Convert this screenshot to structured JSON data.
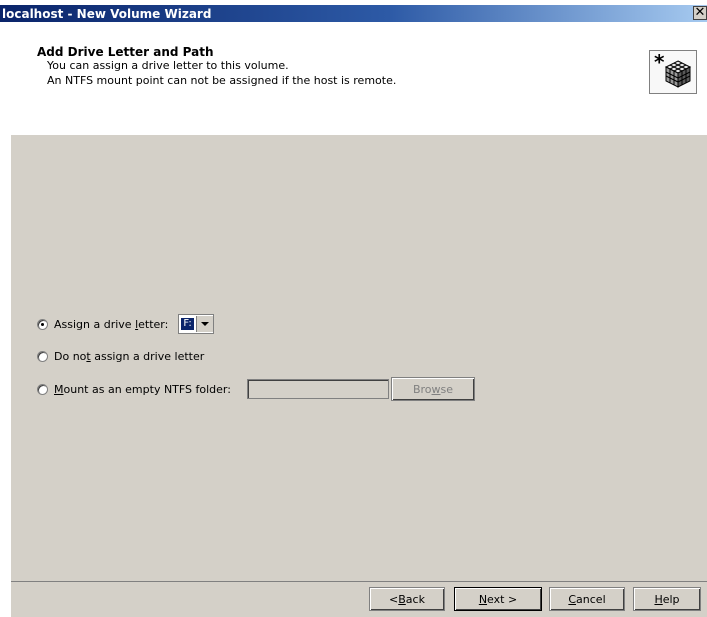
{
  "window": {
    "title": "localhost - New Volume Wizard",
    "close_label": "✕"
  },
  "header": {
    "title": "Add Drive Letter and Path",
    "line1": "You can assign a drive letter to this volume.",
    "line2": "An NTFS mount point can not be assigned if the host is remote.",
    "icon": "wizard-cube-icon"
  },
  "options": {
    "assign_letter": {
      "prefix": "Assign a drive ",
      "underline": "l",
      "suffix": "etter:",
      "selected": true
    },
    "no_letter": {
      "prefix": "Do no",
      "underline": "t",
      "suffix": " assign a drive letter",
      "selected": false
    },
    "mount_folder": {
      "underline": "M",
      "suffix": "ount as an empty NTFS folder:",
      "selected": false
    }
  },
  "drive_letter": {
    "value": "F:"
  },
  "folder_path": {
    "value": ""
  },
  "buttons": {
    "browse": {
      "prefix": "Bro",
      "underline": "w",
      "suffix": "se"
    },
    "back": {
      "prefix": "< ",
      "underline": "B",
      "suffix": "ack"
    },
    "next": {
      "prefix": "",
      "underline": "N",
      "suffix": "ext >"
    },
    "cancel": {
      "prefix": "",
      "underline": "C",
      "suffix": "ancel"
    },
    "help": {
      "prefix": "",
      "underline": "H",
      "suffix": "elp"
    }
  },
  "colors": {
    "title_bar": "#0a246a",
    "dialog_bg": "#d4d0c8"
  }
}
